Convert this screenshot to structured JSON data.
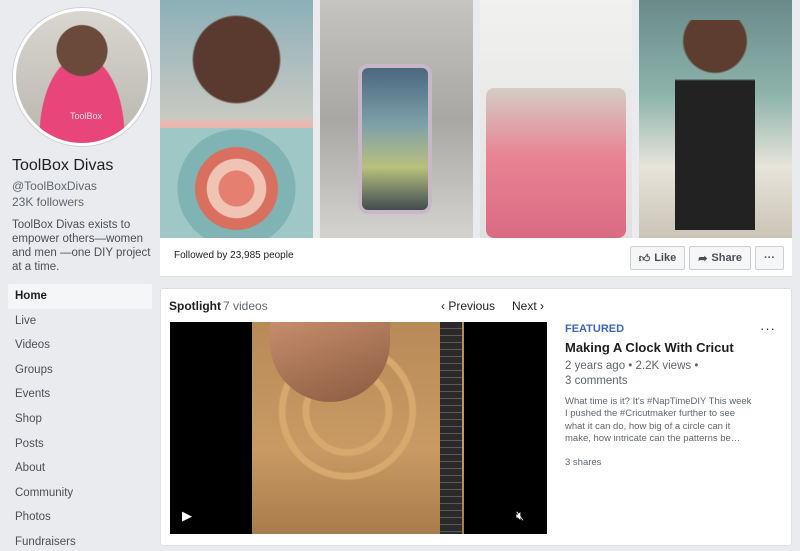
{
  "sidebar": {
    "page_name": "ToolBox Divas",
    "handle": "@ToolBoxDivas",
    "followers": "23K followers",
    "about": "ToolBox Divas exists to empower others—women and men —one DIY project at a time.",
    "avatar_text": "ToolBox",
    "nav": [
      "Home",
      "Live",
      "Videos",
      "Groups",
      "Events",
      "Shop",
      "Posts",
      "About",
      "Community",
      "Photos",
      "Fundraisers"
    ]
  },
  "photo_bar": {
    "followed_by": "Followed by 23,985 people",
    "like_label": "Like",
    "share_label": "Share",
    "more_label": "···"
  },
  "spotlight": {
    "title": "Spotlight",
    "count": "7 videos",
    "previous_label": "Previous",
    "next_label": "Next",
    "featured_label": "FEATURED",
    "video_title": "Making A Clock With Cricut",
    "meta": "2 years ago • 2.2K views •\n3 comments",
    "meta_line1": "2 years ago • 2.2K views •",
    "meta_line2": "3 comments",
    "description": "What time is it? It's #NapTimeDIY This week I pushed the #Cricutmaker further to see what it can do, how big of a circle can it make, how intricate can the patterns be…",
    "shares": "3 shares",
    "more_label": "···"
  }
}
